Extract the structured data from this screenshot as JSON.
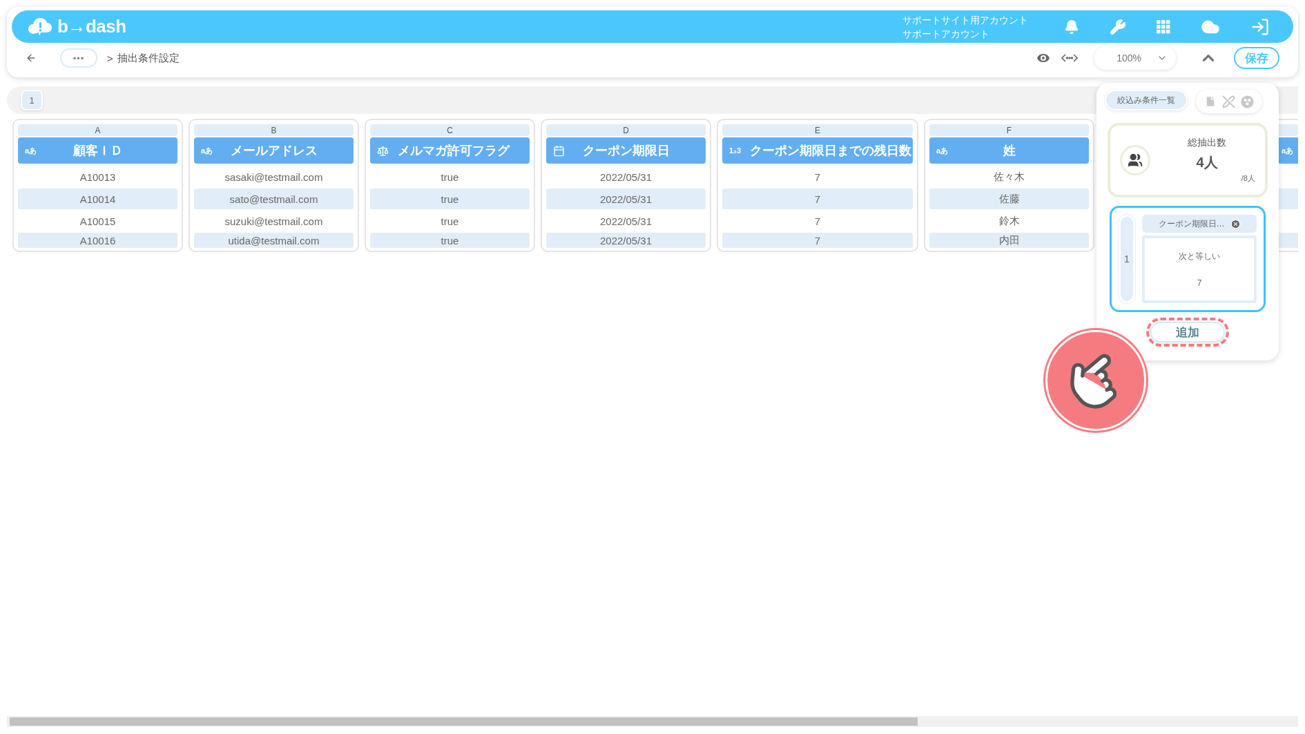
{
  "header": {
    "logo": "b→dash",
    "account_site": "サポートサイト用アカウント",
    "account_name": "サポートアカウント"
  },
  "nav": {
    "overflow": "•••",
    "separator": ">",
    "breadcrumb": "抽出条件設定",
    "zoom": "100%",
    "save": "保存"
  },
  "sheet_tabs": [
    {
      "label": "1",
      "selected": true
    }
  ],
  "columns": [
    {
      "letter": "A",
      "kind": "text",
      "type_label": "aあ",
      "title": "顧客ＩＤ",
      "cells": [
        "A10013",
        "A10014",
        "A10015",
        "A10016"
      ]
    },
    {
      "letter": "B",
      "kind": "text",
      "type_label": "aあ",
      "title": "メールアドレス",
      "cells": [
        "sasaki@testmail.com",
        "sato@testmail.com",
        "suzuki@testmail.com",
        "utida@testmail.com"
      ]
    },
    {
      "letter": "C",
      "kind": "boolean",
      "title": "メルマガ許可フラグ",
      "cells": [
        "true",
        "true",
        "true",
        "true"
      ]
    },
    {
      "letter": "D",
      "kind": "date",
      "title": "クーポン期限日",
      "cells": [
        "2022/05/31",
        "2022/05/31",
        "2022/05/31",
        "2022/05/31"
      ]
    },
    {
      "letter": "E",
      "kind": "number",
      "type_label": "1₂3",
      "title": "クーポン期限日までの残日数",
      "cells": [
        "7",
        "7",
        "7",
        "7"
      ]
    },
    {
      "letter": "F",
      "kind": "text",
      "type_label": "aあ",
      "title": "姓",
      "cells": [
        "佐々木",
        "佐藤",
        "鈴木",
        "内田"
      ]
    }
  ],
  "next_column": {
    "type_label": "aあ"
  },
  "panel": {
    "tab": "絞込み条件一覧",
    "total_label": "総抽出数",
    "total": "4人",
    "of_total": "/8人",
    "conditions": [
      {
        "index": "1",
        "field": "クーポン期限日…",
        "operator": "次と等しい",
        "value": "7"
      }
    ],
    "add": "追加"
  }
}
